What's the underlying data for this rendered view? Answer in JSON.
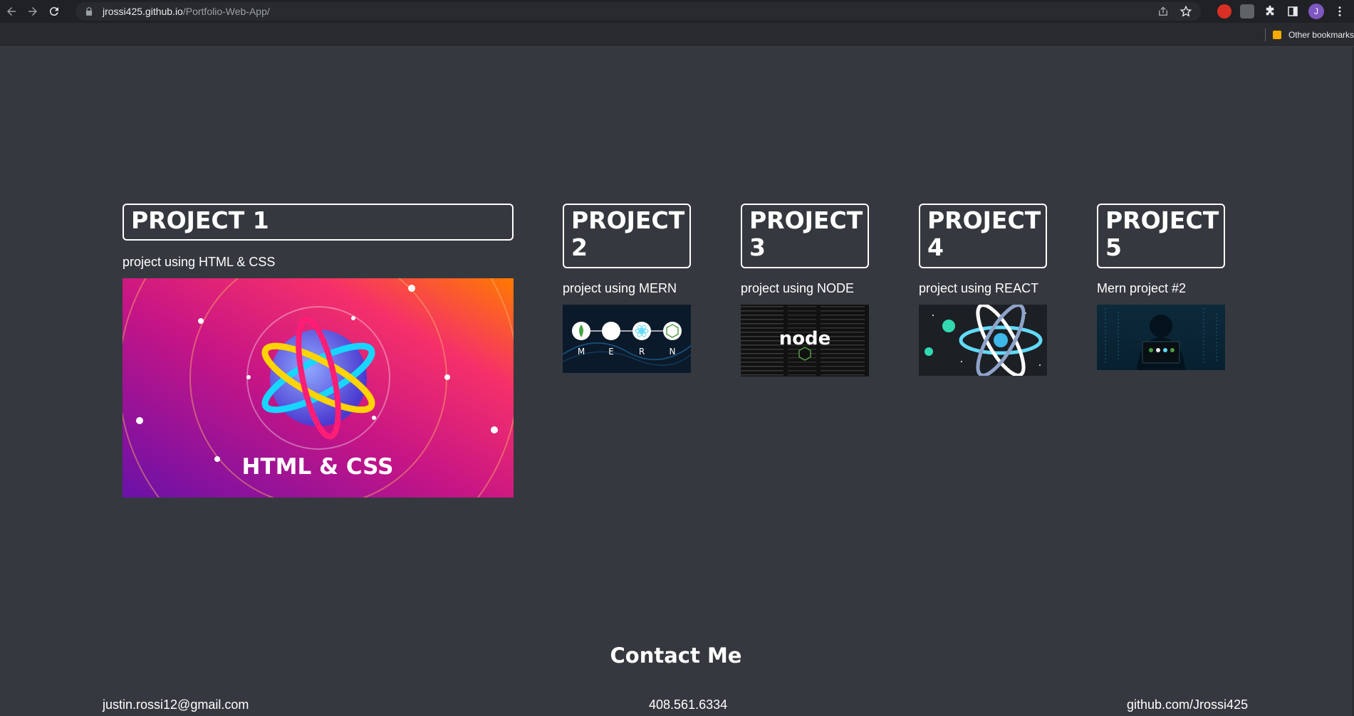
{
  "browser": {
    "url_host": "jrossi425.github.io",
    "url_path": "/Portfolio-Web-App/",
    "bookmark_other": "Other bookmarks",
    "avatar_letter": "J"
  },
  "projects": [
    {
      "title": "PROJECT 1",
      "description": "project using HTML & CSS",
      "image_caption": "HTML & CSS"
    },
    {
      "title": "PROJECT 2",
      "description": "project using MERN",
      "image_letters": [
        "M",
        "E",
        "R",
        "N"
      ]
    },
    {
      "title": "PROJECT 3",
      "description": "project using NODE",
      "image_caption": "node"
    },
    {
      "title": "PROJECT 4",
      "description": "project using REACT"
    },
    {
      "title": "PROJECT 5",
      "description": "Mern project #2"
    }
  ],
  "contact": {
    "title": "Contact Me",
    "email": "justin.rossi12@gmail.com",
    "phone": "408.561.6334",
    "github": "github.com/Jrossi425"
  },
  "colors": {
    "page_bg": "#35393f",
    "text": "#ffffff",
    "chrome_bg": "#202124"
  }
}
